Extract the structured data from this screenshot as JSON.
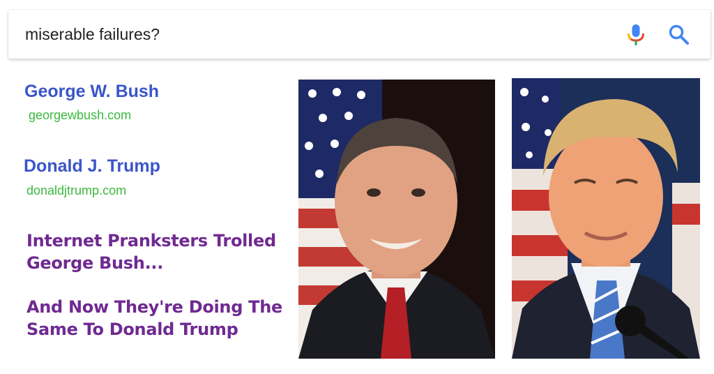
{
  "search": {
    "query": "miserable failures?"
  },
  "results": [
    {
      "title": "George W. Bush",
      "url": "georgewbush.com"
    },
    {
      "title": "Donald J. Trump",
      "url": "donaldjtrump.com"
    }
  ],
  "headlines": [
    {
      "line1": "Internet Pranksters Trolled",
      "line2": "George Bush..."
    },
    {
      "line1": "And Now They're Doing The",
      "line2": "Same To Donald Trump"
    }
  ],
  "colors": {
    "result_title": "#3a55c9",
    "result_url": "#3ab93f",
    "headline": "#6f2a91"
  }
}
